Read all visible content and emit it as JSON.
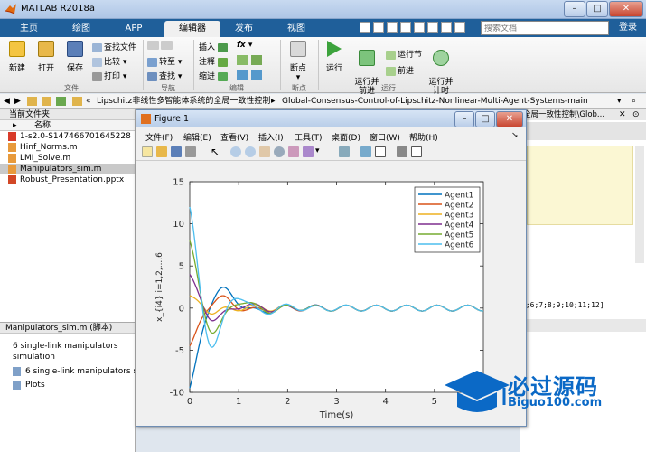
{
  "window": {
    "title": "MATLAB R2018a"
  },
  "tabs": [
    {
      "label": "主页"
    },
    {
      "label": "绘图"
    },
    {
      "label": "APP"
    },
    {
      "label": "编辑器"
    },
    {
      "label": "发布"
    },
    {
      "label": "视图"
    }
  ],
  "search": {
    "placeholder": "搜索文档"
  },
  "login_label": "登录",
  "ribbon": {
    "new": "新建",
    "open": "打开",
    "save": "保存",
    "find_files": "查找文件",
    "compare": "比较",
    "print": "打印",
    "goto": "转至",
    "find": "查找",
    "insert": "插入",
    "comment": "注释",
    "indent": "缩进",
    "fx": "fx",
    "breakpoints": "断点",
    "run": "运行",
    "run_advance": "运行并\n前进",
    "run_section": "运行节",
    "advance": "前进",
    "run_time": "运行并\n计时",
    "sections": {
      "file": "文件",
      "navigate": "导航",
      "edit": "编辑",
      "breakpoints": "断点",
      "run": "运行"
    }
  },
  "address": {
    "path_prefix": "«",
    "segment1": "Lipschitz非线性多智能体系统的全局一致性控制",
    "arrow": "▸",
    "segment2": "Global-Consensus-Control-of-Lipschitz-Nonlinear-Multi-Agent-Systems-main"
  },
  "current_folder": {
    "header": "当前文件夹",
    "col_name": "名称",
    "files": [
      {
        "name": "1-s2.0-S147466701645228",
        "type": "pdf"
      },
      {
        "name": "Hinf_Norms.m",
        "type": "m"
      },
      {
        "name": "LMI_Solve.m",
        "type": "m"
      },
      {
        "name": "Manipulators_sim.m",
        "type": "m",
        "selected": true
      },
      {
        "name": "Robust_Presentation.pptx",
        "type": "pptx"
      }
    ]
  },
  "details": {
    "header": "Manipulators_sim.m  (脚本)",
    "desc": "6 single-link manipulators simulation",
    "items": [
      {
        "label": "6 single-link manipulators s"
      },
      {
        "label": "Plots"
      }
    ]
  },
  "right_panel": {
    "path_fragment": "全局一致性控制\\Glob...",
    "code_fragment": "5;6;7;8;9;10;11;12]"
  },
  "figure": {
    "title": "Figure 1",
    "menu": [
      "文件(F)",
      "编辑(E)",
      "查看(V)",
      "插入(I)",
      "工具(T)",
      "桌面(D)",
      "窗口(W)",
      "帮助(H)"
    ]
  },
  "chart_data": {
    "type": "line",
    "title": "",
    "xlabel": "Time(s)",
    "ylabel": "x_{i4} i=1,2,...,6",
    "xlim": [
      0,
      6
    ],
    "ylim": [
      -10,
      15
    ],
    "xticks": [
      0,
      1,
      2,
      3,
      4,
      5
    ],
    "yticks": [
      -10,
      -5,
      0,
      5,
      10,
      15
    ],
    "legend_position": "top-right",
    "series": [
      {
        "name": "Agent1",
        "color": "#0072bd",
        "initial": -9.5
      },
      {
        "name": "Agent2",
        "color": "#d95319",
        "initial": -4.5
      },
      {
        "name": "Agent3",
        "color": "#edb120",
        "initial": 1.5
      },
      {
        "name": "Agent4",
        "color": "#7e2f8e",
        "initial": 4.0
      },
      {
        "name": "Agent5",
        "color": "#77ac30",
        "initial": 8.0
      },
      {
        "name": "Agent6",
        "color": "#4dbeee",
        "initial": 12.0
      }
    ]
  },
  "watermark": {
    "text": "必过源码",
    "url": "Biguo100.com"
  }
}
